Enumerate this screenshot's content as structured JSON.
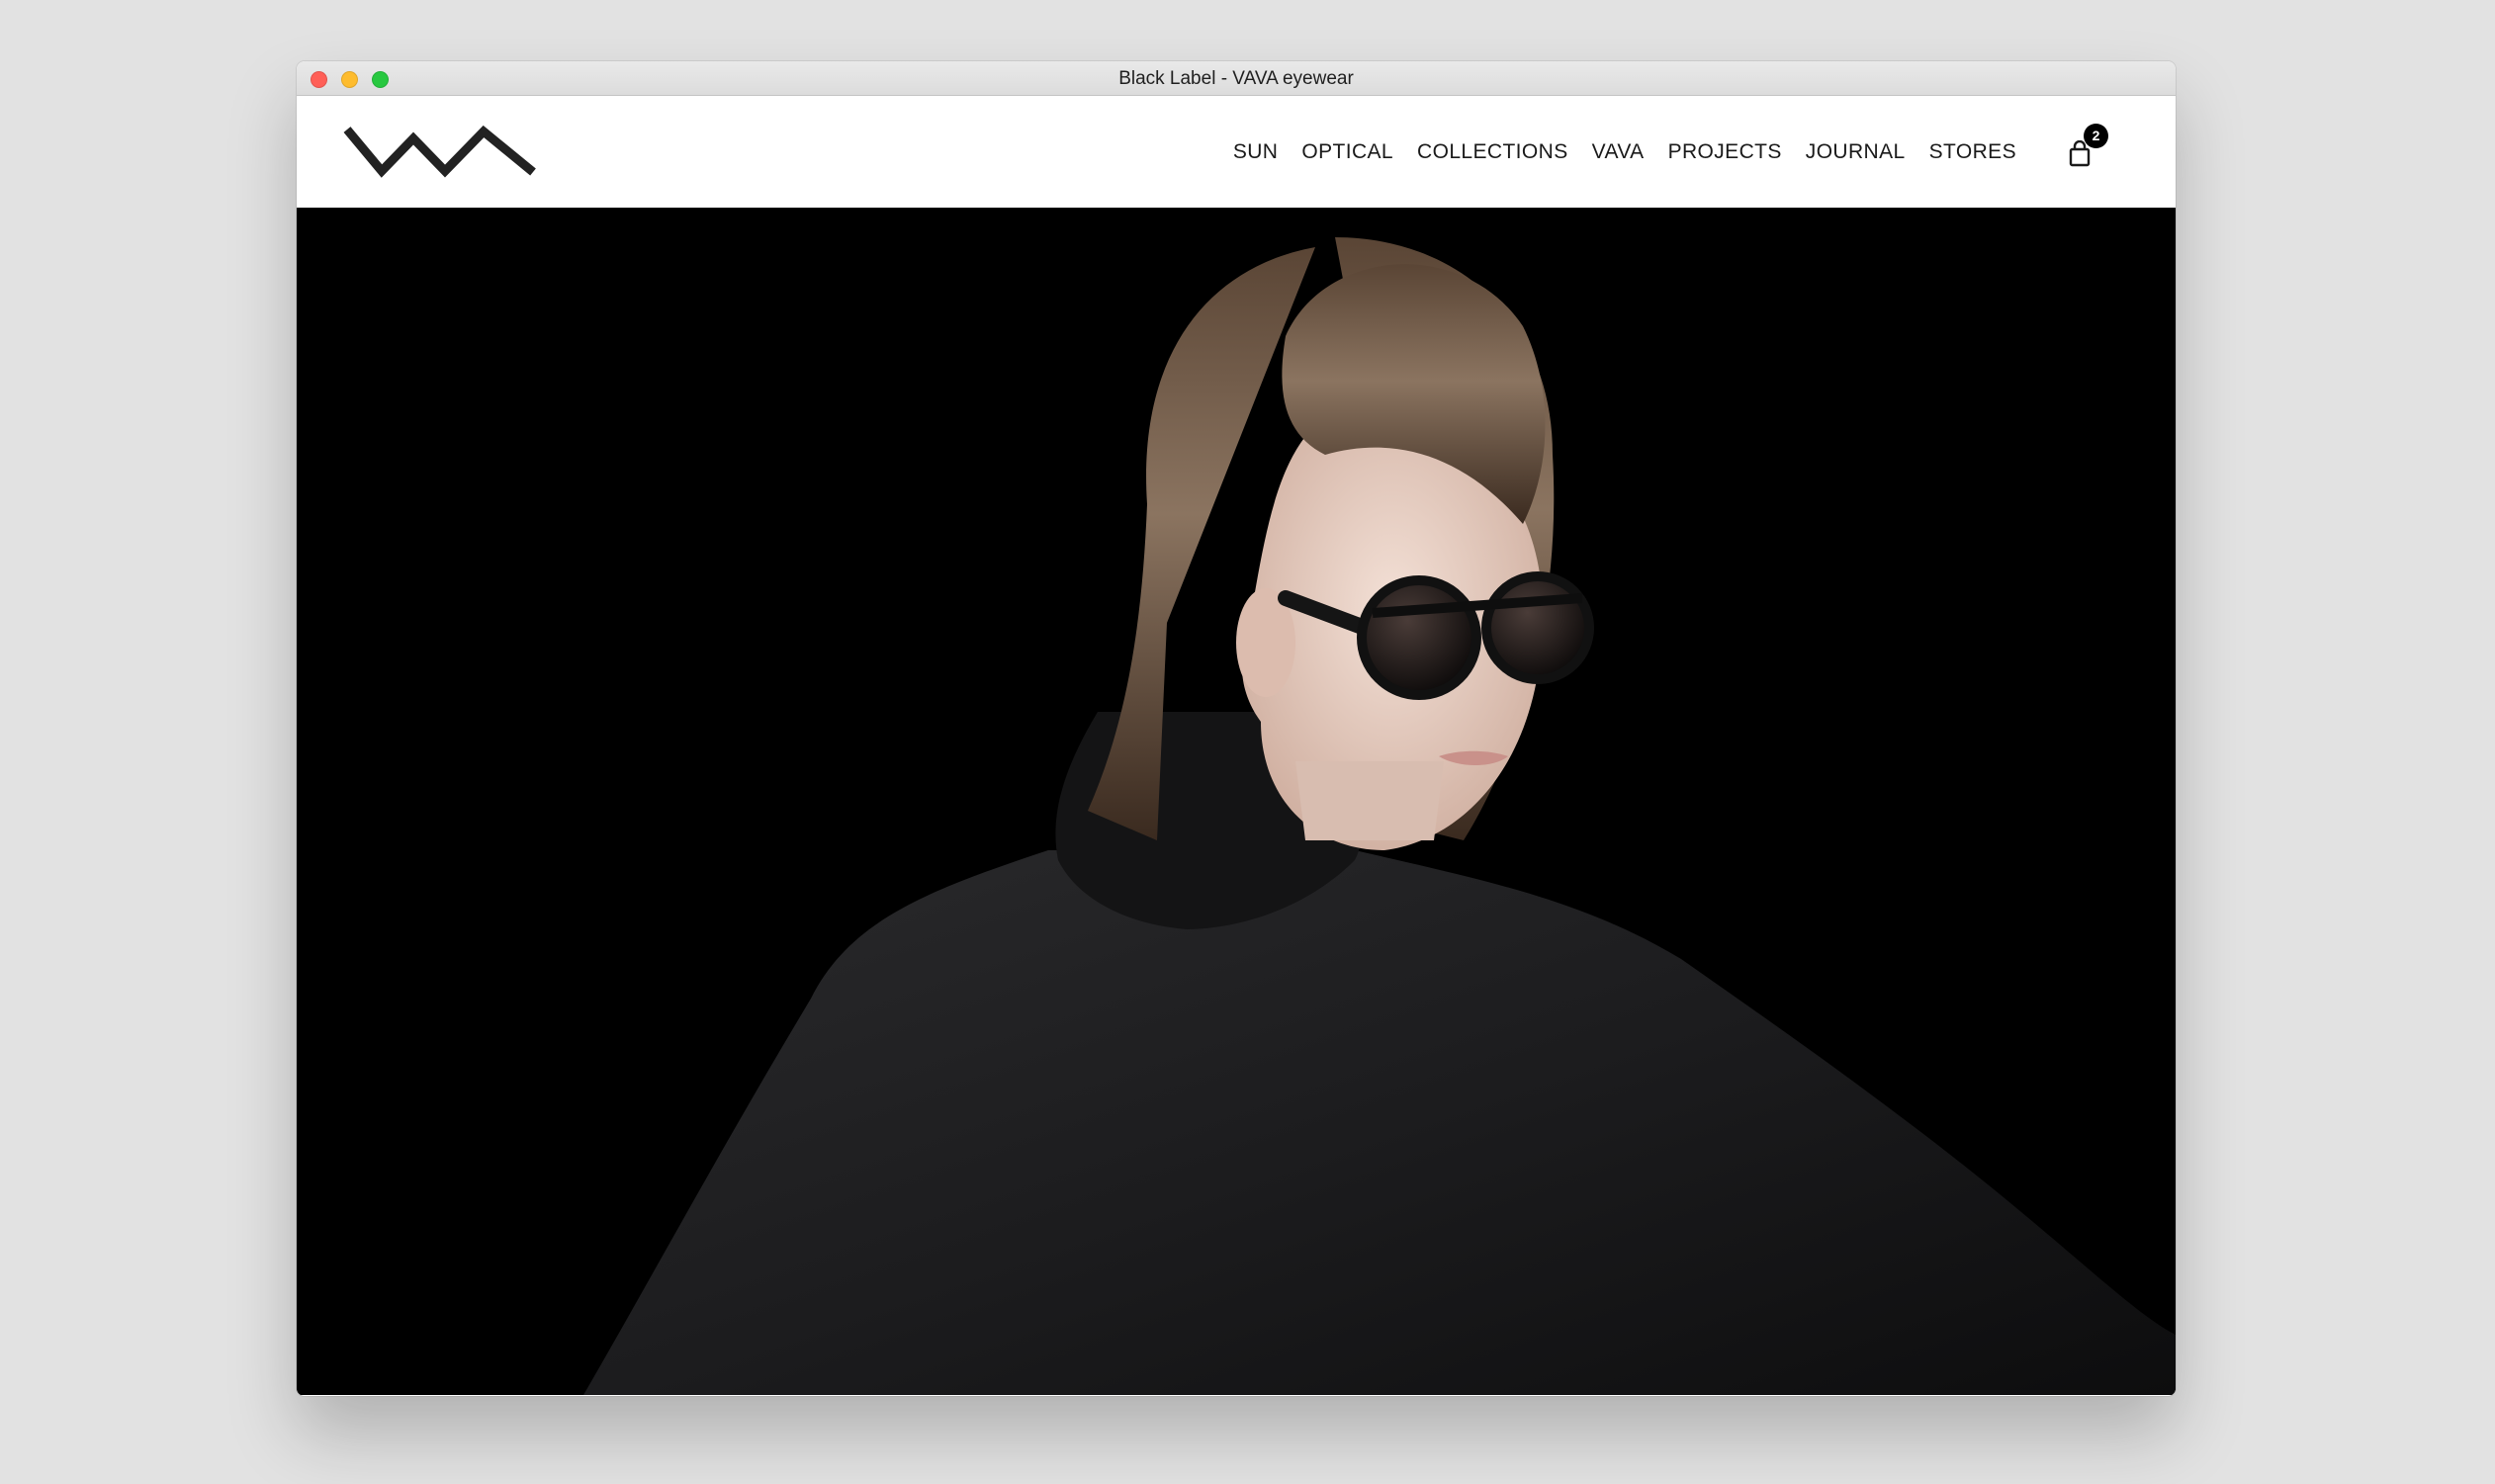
{
  "window": {
    "title": "Black Label - VAVA eyewear",
    "controls": {
      "close_color": "#ff5f57",
      "minimize_color": "#febc2e",
      "zoom_color": "#28c840"
    }
  },
  "header": {
    "logo_name": "VAVA",
    "nav": [
      {
        "label": "SUN"
      },
      {
        "label": "OPTICAL"
      },
      {
        "label": "COLLECTIONS"
      },
      {
        "label": "VAVA"
      },
      {
        "label": "PROJECTS"
      },
      {
        "label": "JOURNAL"
      },
      {
        "label": "STORES"
      }
    ],
    "cart": {
      "icon": "shopping-bag-icon",
      "count": "2"
    }
  },
  "hero": {
    "background_color": "#000000",
    "image": "model in black turtleneck wearing round black VAVA sunglasses"
  },
  "colors": {
    "text": "#1a1a1a",
    "badge": "#000000",
    "page_background": "#e2e2e2"
  }
}
